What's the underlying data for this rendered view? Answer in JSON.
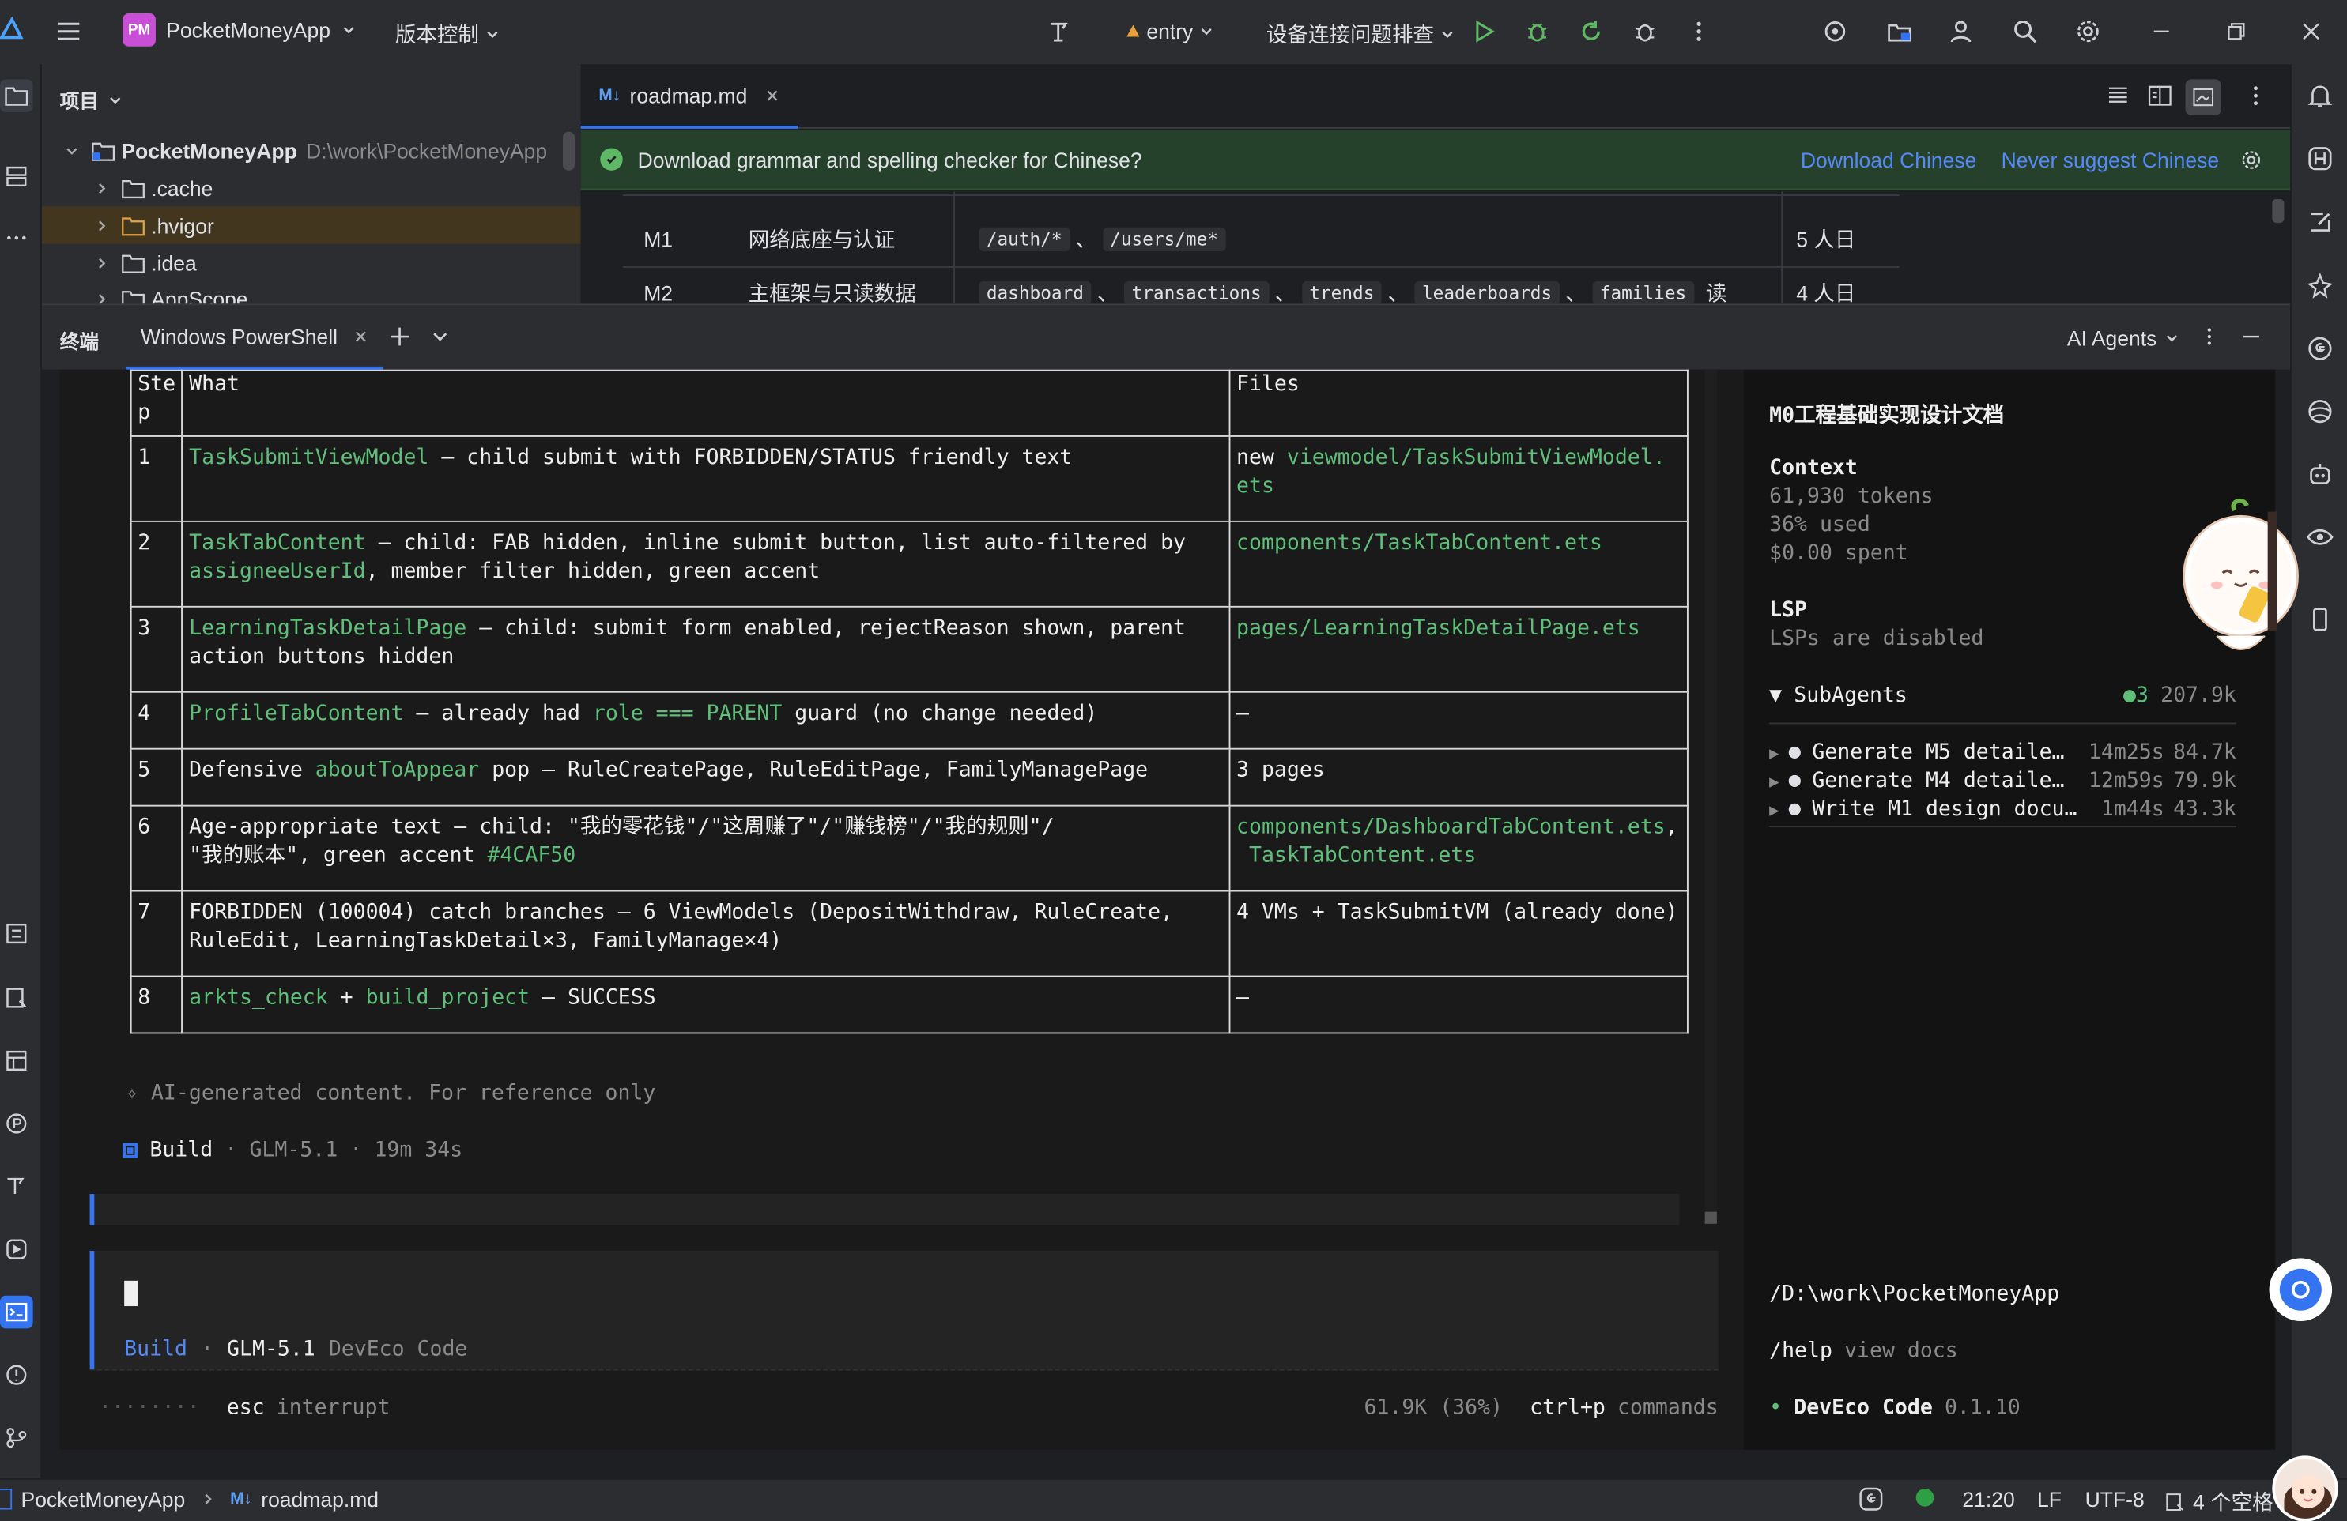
{
  "titlebar": {
    "app_badge": "PM",
    "project_name": "PocketMoneyApp",
    "vcs_label": "版本控制",
    "run_config": "entry",
    "device_label": "设备连接问题排查"
  },
  "project_panel": {
    "title": "项目",
    "root_name": "PocketMoneyApp",
    "root_path": "D:\\work\\PocketMoneyApp",
    "items": [
      ".cache",
      ".hvigor",
      ".idea",
      "AppScope"
    ]
  },
  "editor": {
    "tab_label": "roadmap.md",
    "tab_prefix": "M↓",
    "notification": {
      "text": "Download grammar and spelling checker for Chinese?",
      "action1": "Download Chinese",
      "action2": "Never suggest Chinese"
    },
    "rows": [
      {
        "id": "M1",
        "name": "网络底座与认证",
        "tags": [
          "/auth/*",
          "/users/me*"
        ],
        "seps": [
          "、"
        ],
        "tail": "",
        "days": "5 人日"
      },
      {
        "id": "M2",
        "name": "主框架与只读数据",
        "tags": [
          "dashboard",
          "transactions",
          "trends",
          "leaderboards",
          "families"
        ],
        "seps": [
          "、",
          "、",
          "、",
          "、"
        ],
        "tail": "读",
        "days": "4 人日"
      }
    ]
  },
  "terminal": {
    "title": "终端",
    "tab_label": "Windows PowerShell",
    "agents_label": "AI Agents",
    "table_header": {
      "step": "Ste\np",
      "what": "What",
      "files": "Files"
    },
    "table_rows": [
      {
        "step": "1",
        "what": [
          [
            "g",
            "TaskSubmitViewModel"
          ],
          [
            "w",
            " — child submit with FORBIDDEN/STATUS friendly text"
          ]
        ],
        "files": [
          [
            "w",
            "new "
          ],
          [
            "g",
            "viewmodel/TaskSubmitViewModel.\nets"
          ]
        ]
      },
      {
        "step": "2",
        "what": [
          [
            "g",
            "TaskTabContent"
          ],
          [
            "w",
            " — child: FAB hidden, inline submit button, list auto-filtered by\n"
          ],
          [
            "g",
            "assigneeUserId"
          ],
          [
            "w",
            ", member filter hidden, green accent"
          ]
        ],
        "files": [
          [
            "g",
            "components/TaskTabContent.ets"
          ]
        ]
      },
      {
        "step": "3",
        "what": [
          [
            "g",
            "LearningTaskDetailPage"
          ],
          [
            "w",
            " — child: submit form enabled, rejectReason shown, parent\naction buttons hidden"
          ]
        ],
        "files": [
          [
            "g",
            "pages/LearningTaskDetailPage.ets"
          ]
        ]
      },
      {
        "step": "4",
        "what": [
          [
            "g",
            "ProfileTabContent"
          ],
          [
            "w",
            " — already had "
          ],
          [
            "g",
            "role === PARENT"
          ],
          [
            "w",
            " guard (no change needed)"
          ]
        ],
        "files": [
          [
            "w",
            "—"
          ]
        ]
      },
      {
        "step": "5",
        "what": [
          [
            "w",
            "Defensive "
          ],
          [
            "g",
            "aboutToAppear"
          ],
          [
            "w",
            " pop — RuleCreatePage, RuleEditPage, FamilyManagePage"
          ]
        ],
        "files": [
          [
            "w",
            "3 pages"
          ]
        ]
      },
      {
        "step": "6",
        "what": [
          [
            "w",
            "Age-appropriate text — child: \"我的零花钱\"/\"这周赚了\"/\"赚钱榜\"/\"我的规则\"/\n\"我的账本\", green accent "
          ],
          [
            "g",
            "#4CAF50"
          ]
        ],
        "files": [
          [
            "g",
            "components/DashboardTabContent.ets"
          ],
          [
            "w",
            ",\n "
          ],
          [
            "g",
            "TaskTabContent.ets"
          ]
        ]
      },
      {
        "step": "7",
        "what": [
          [
            "w",
            "FORBIDDEN (100004) catch branches — 6 ViewModels (DepositWithdraw, RuleCreate,\nRuleEdit, LearningTaskDetail×3, FamilyManage×4)"
          ]
        ],
        "files": [
          [
            "w",
            "4 VMs + TaskSubmitVM (already done)"
          ]
        ]
      },
      {
        "step": "8",
        "what": [
          [
            "g",
            "arkts_check"
          ],
          [
            "w",
            " + "
          ],
          [
            "g",
            "build_project"
          ],
          [
            "w",
            " — SUCCESS"
          ]
        ],
        "files": [
          [
            "w",
            "—"
          ]
        ]
      }
    ],
    "ai_note": "✧ AI-generated content. For reference only",
    "build_line": {
      "label": "Build",
      "model": "GLM-5.1",
      "time": "19m 34s"
    },
    "prompt_mode": "Build",
    "prompt_model": "GLM-5.1",
    "prompt_app": "DevEco Code",
    "dots": "········",
    "esc_key": "esc",
    "esc_label": "interrupt",
    "usage": "61.9K (36%)",
    "cmd_key": "ctrl+p",
    "cmd_label": "commands"
  },
  "agent_panel": {
    "title": "M0工程基础实现设计文档",
    "context_label": "Context",
    "tokens": "61,930 tokens",
    "used": "36% used",
    "spent": "$0.00 spent",
    "lsp_label": "LSP",
    "lsp_status": "LSPs are disabled",
    "subagents_label": "SubAgents",
    "subagents_count": "●3",
    "subagents_total": "207.9k",
    "subagents": [
      {
        "name": "Generate M5 detaile…",
        "time": "14m25s",
        "tokens": "84.7k"
      },
      {
        "name": "Generate M4 detaile…",
        "time": "12m59s",
        "tokens": "79.9k"
      },
      {
        "name": "Write M1 design docu…",
        "time": "1m44s",
        "tokens": "43.3k"
      }
    ],
    "path": "/D:\\work\\PocketMoneyApp",
    "help_cmd": "/help",
    "help_label": "view docs",
    "brand": "DevEco Code",
    "version": "0.1.10"
  },
  "statusbar": {
    "crumb_project": "PocketMoneyApp",
    "crumb_file": "roadmap.md",
    "crumb_file_prefix": "M↓",
    "position": "21:20",
    "line_sep": "LF",
    "encoding": "UTF-8",
    "indent": "4 个空格"
  },
  "colors": {
    "accent": "#3574f0",
    "green": "#5fbf7a",
    "purple": "#b57cf5",
    "notify_bg": "#25402b",
    "link": "#548af7"
  }
}
